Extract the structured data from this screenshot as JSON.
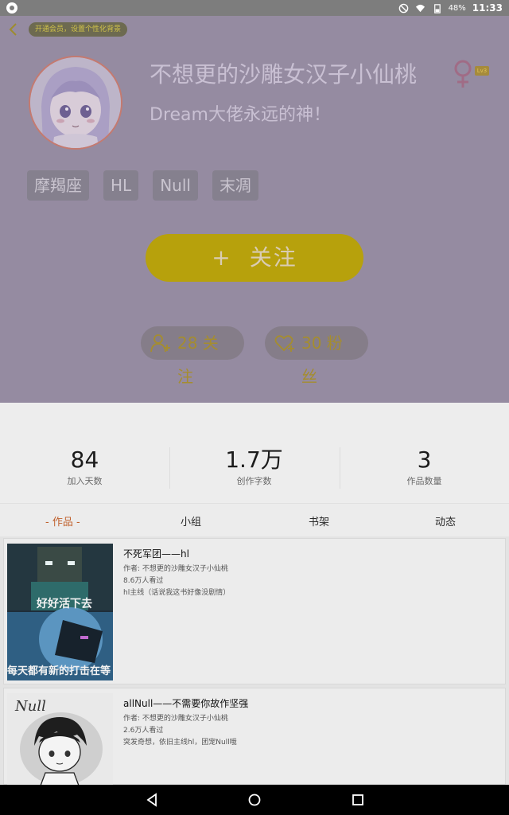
{
  "status_bar": {
    "battery": "48%",
    "time": "11:33"
  },
  "header": {
    "vip_prompt": "开通会员，设置个性化背景",
    "nickname": "不想更的沙雕女汉子小仙桃",
    "level": "Lv3",
    "signature": "Dream大佬永远的神！",
    "tags": [
      "摩羯座",
      "HL",
      "Null",
      "末凋"
    ],
    "follow_button": {
      "plus": "+",
      "label": "关注"
    },
    "following": "28 关注",
    "fans": "30 粉丝"
  },
  "stats": [
    {
      "value": "84",
      "label": "加入天数"
    },
    {
      "value": "1.7万",
      "label": "创作字数"
    },
    {
      "value": "3",
      "label": "作品数量"
    }
  ],
  "tabs": [
    "- 作品 -",
    "小组",
    "书架",
    "动态"
  ],
  "works": [
    {
      "title": "不死军团——hl",
      "author": "作者: 不想更的沙雕女汉子小仙桃",
      "views": "8.6万人看过",
      "desc": "hl主线（话说我这书好像没剧情）",
      "thumb_text_top": "好好活下去",
      "thumb_text_bottom": "每天都有新的打击在等"
    },
    {
      "title": "allNull——不需要你故作坚强",
      "author": "作者: 不想更的沙雕女汉子小仙桃",
      "views": "2.6万人看过",
      "desc": "突发奇想，依旧主线hl，团宠Null哦",
      "thumb_text": "Null"
    }
  ],
  "colors": {
    "header_bg": "#958ba1",
    "follow_button": "#b7a10c",
    "active_tab": "#c0602c"
  }
}
